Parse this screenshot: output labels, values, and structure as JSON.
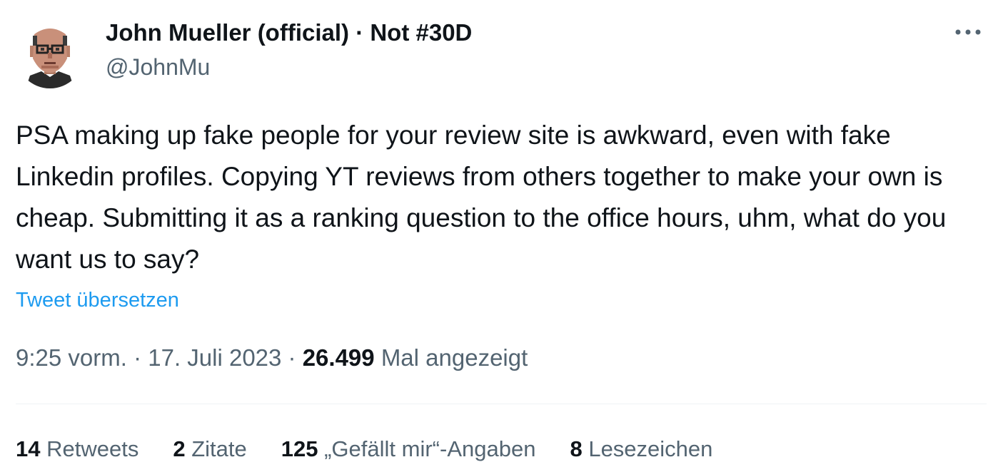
{
  "author": {
    "display_name": "John Mueller (official) · Not #30D",
    "handle": "@JohnMu"
  },
  "tweet": {
    "text": "PSA making up fake people for your review site is awkward, even with fake Linkedin profiles. Copying YT reviews from others together to make your own is cheap. Submitting it as a ranking question to the office hours, uhm, what do you want us to say?",
    "translate_label": "Tweet übersetzen"
  },
  "meta": {
    "time": "9:25 vorm.",
    "separator": " · ",
    "date": "17. Juli 2023",
    "views_count": "26.499",
    "views_label": "Mal angezeigt"
  },
  "stats": {
    "retweets": {
      "count": "14",
      "label": "Retweets"
    },
    "quotes": {
      "count": "2",
      "label": "Zitate"
    },
    "likes": {
      "count": "125",
      "label": "„Gefällt mir“-Angaben"
    },
    "bookmarks": {
      "count": "8",
      "label": "Lesezeichen"
    }
  },
  "icons": {
    "more": "more-icon",
    "avatar": "avatar-pixel-portrait"
  },
  "colors": {
    "text": "#0f1419",
    "secondary": "#536471",
    "link": "#1d9bf0",
    "divider": "#eff3f4"
  }
}
